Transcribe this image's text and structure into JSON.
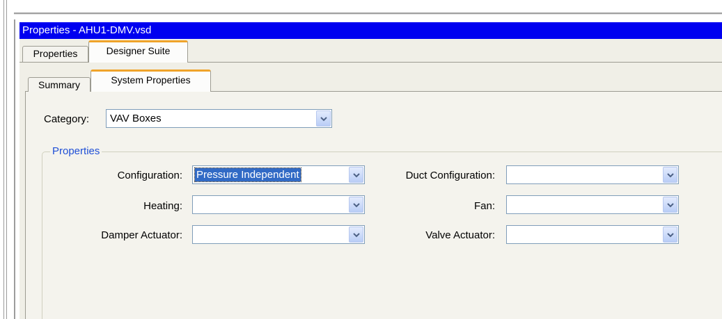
{
  "window": {
    "title": "Properties - AHU1-DMV.vsd"
  },
  "outer_tabs": [
    {
      "label": "Properties",
      "active": false
    },
    {
      "label": "Designer Suite",
      "active": true
    }
  ],
  "inner_tabs": [
    {
      "label": "Summary",
      "active": false
    },
    {
      "label": "System Properties",
      "active": true
    }
  ],
  "category": {
    "label": "Category:",
    "value": "VAV Boxes"
  },
  "properties_group": {
    "title": "Properties",
    "fields": {
      "configuration": {
        "label": "Configuration:",
        "value": "Pressure Independent"
      },
      "heating": {
        "label": "Heating:",
        "value": ""
      },
      "damper_actuator": {
        "label": "Damper Actuator:",
        "value": ""
      },
      "duct_configuration": {
        "label": "Duct Configuration:",
        "value": ""
      },
      "fan": {
        "label": "Fan:",
        "value": ""
      },
      "valve_actuator": {
        "label": "Valve Actuator:",
        "value": ""
      }
    }
  },
  "colors": {
    "titlebar": "#0000f0",
    "active_tab_accent": "#f0a32a",
    "group_title": "#1f4fd6",
    "selection": "#316ac5"
  },
  "icons": {
    "dropdown": "chevron-down-icon"
  }
}
